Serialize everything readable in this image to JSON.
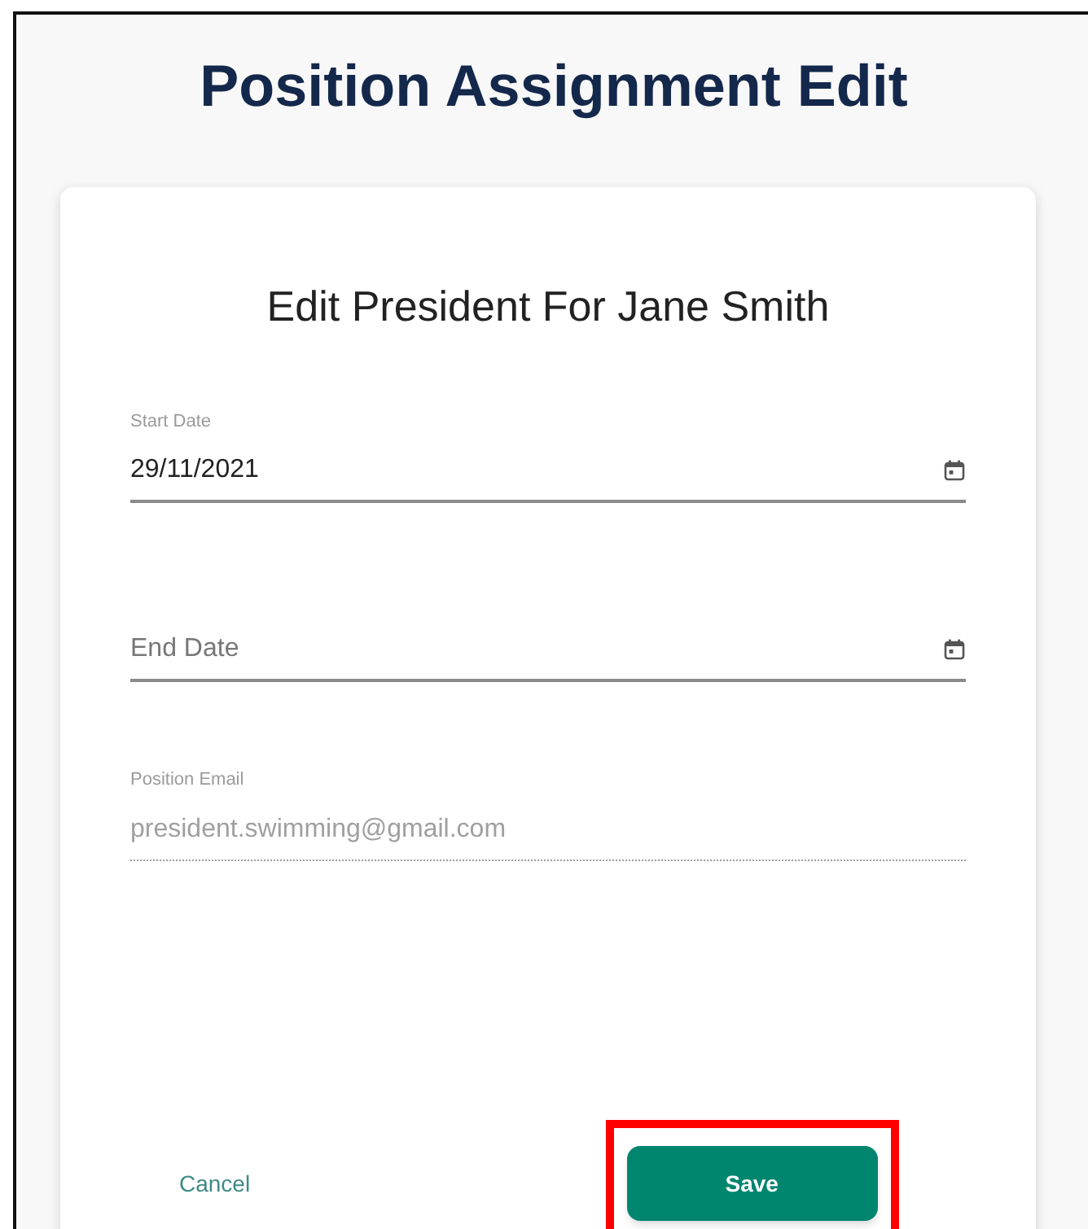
{
  "page": {
    "title": "Position Assignment Edit"
  },
  "card": {
    "heading": "Edit President For Jane Smith",
    "fields": [
      {
        "kind": "date",
        "label": "Start Date",
        "value": "29/11/2021",
        "disabled": false
      },
      {
        "kind": "date",
        "placeholder": "End Date",
        "disabled": false
      },
      {
        "kind": "text",
        "label": "Position Email",
        "value": "president.swimming@gmail.com",
        "disabled": true
      }
    ],
    "buttons": [
      {
        "kind": "text",
        "label": "Cancel",
        "highlighted": false
      },
      {
        "kind": "filled",
        "label": "Save",
        "highlighted": true
      }
    ]
  }
}
